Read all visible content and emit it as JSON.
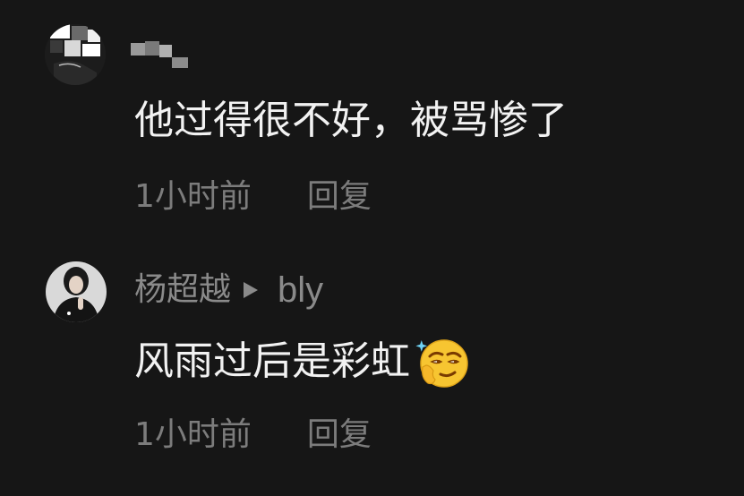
{
  "comments": [
    {
      "text": "他过得很不好，被骂惨了",
      "time": "1小时前",
      "reply_label": "回复"
    },
    {
      "username": "杨超越",
      "reply_to": "bly",
      "text": "风雨过后是彩虹",
      "emoji": "smug-face-emoji",
      "time": "1小时前",
      "reply_label": "回复"
    }
  ],
  "icons": {
    "reply_arrow": "play-arrow-icon"
  },
  "colors": {
    "background": "#161616",
    "primary_text": "#f2f2f2",
    "secondary_text": "#8a8a8a"
  }
}
